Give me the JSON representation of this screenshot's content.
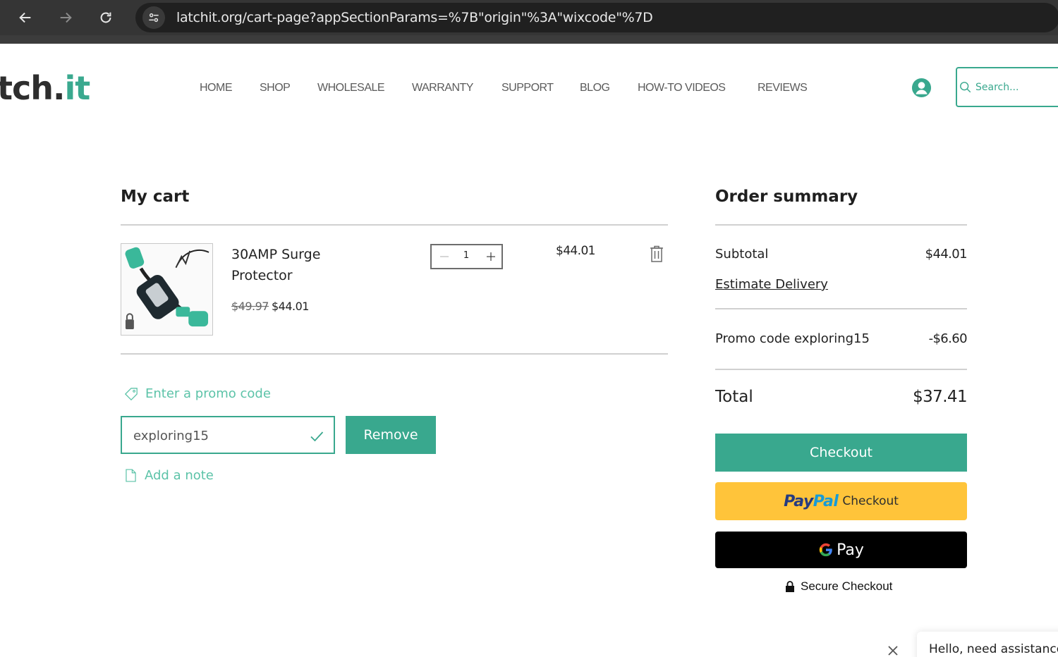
{
  "browser": {
    "url": "latchit.org/cart-page?appSectionParams=%7B\"origin\"%3A\"wixcode\"%7D"
  },
  "header": {
    "logo_dark": "tch.",
    "logo_accent": "it",
    "nav": [
      "HOME",
      "SHOP",
      "WHOLESALE",
      "WARRANTY",
      "SUPPORT",
      "BLOG",
      "HOW-TO VIDEOS",
      "REVIEWS"
    ],
    "search_placeholder": "Search..."
  },
  "cart": {
    "title": "My cart",
    "item": {
      "name": "30AMP Surge Protector",
      "original_price": "$49.97",
      "price": "$44.01",
      "quantity": "1",
      "line_total": "$44.01"
    },
    "promo_link": "Enter a promo code",
    "promo_value": "exploring15",
    "remove_label": "Remove",
    "note_link": "Add a note"
  },
  "summary": {
    "title": "Order summary",
    "subtotal_label": "Subtotal",
    "subtotal_value": "$44.01",
    "estimate_delivery": "Estimate Delivery",
    "promo_label": "Promo code exploring15",
    "promo_value": "-$6.60",
    "total_label": "Total",
    "total_value": "$37.41",
    "checkout_label": "Checkout",
    "paypal_logo_a": "Pay",
    "paypal_logo_b": "Pal",
    "paypal_label": "Checkout",
    "gpay_g": "G",
    "gpay_label": "Pay",
    "secure_label": "Secure Checkout"
  },
  "chat": {
    "message": "Hello, need assistance"
  },
  "colors": {
    "accent": "#39a88e",
    "accent_light": "#5cc3a8",
    "paypal": "#ffc43a",
    "browser_bar": "#353535"
  }
}
